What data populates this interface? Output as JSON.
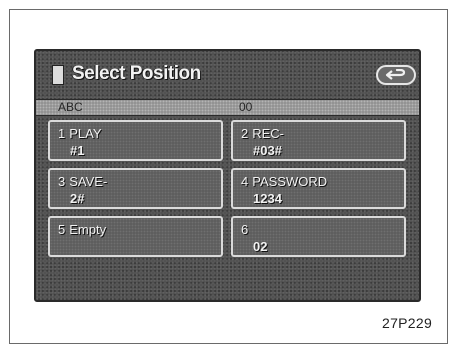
{
  "screen": {
    "title": "Select Position",
    "back_icon": "back-arrow-icon",
    "info_left": "ABC",
    "info_right": "00"
  },
  "slots": [
    {
      "number": "1",
      "name": "PLAY",
      "value": "#1"
    },
    {
      "number": "2",
      "name": "REC-",
      "value": "#03#"
    },
    {
      "number": "3",
      "name": "SAVE-",
      "value": "2#"
    },
    {
      "number": "4",
      "name": "PASSWORD",
      "value": "1234"
    },
    {
      "number": "5",
      "name": "Empty",
      "value": ""
    },
    {
      "number": "6",
      "name": "",
      "value": "02"
    }
  ],
  "figure_code": "27P229"
}
